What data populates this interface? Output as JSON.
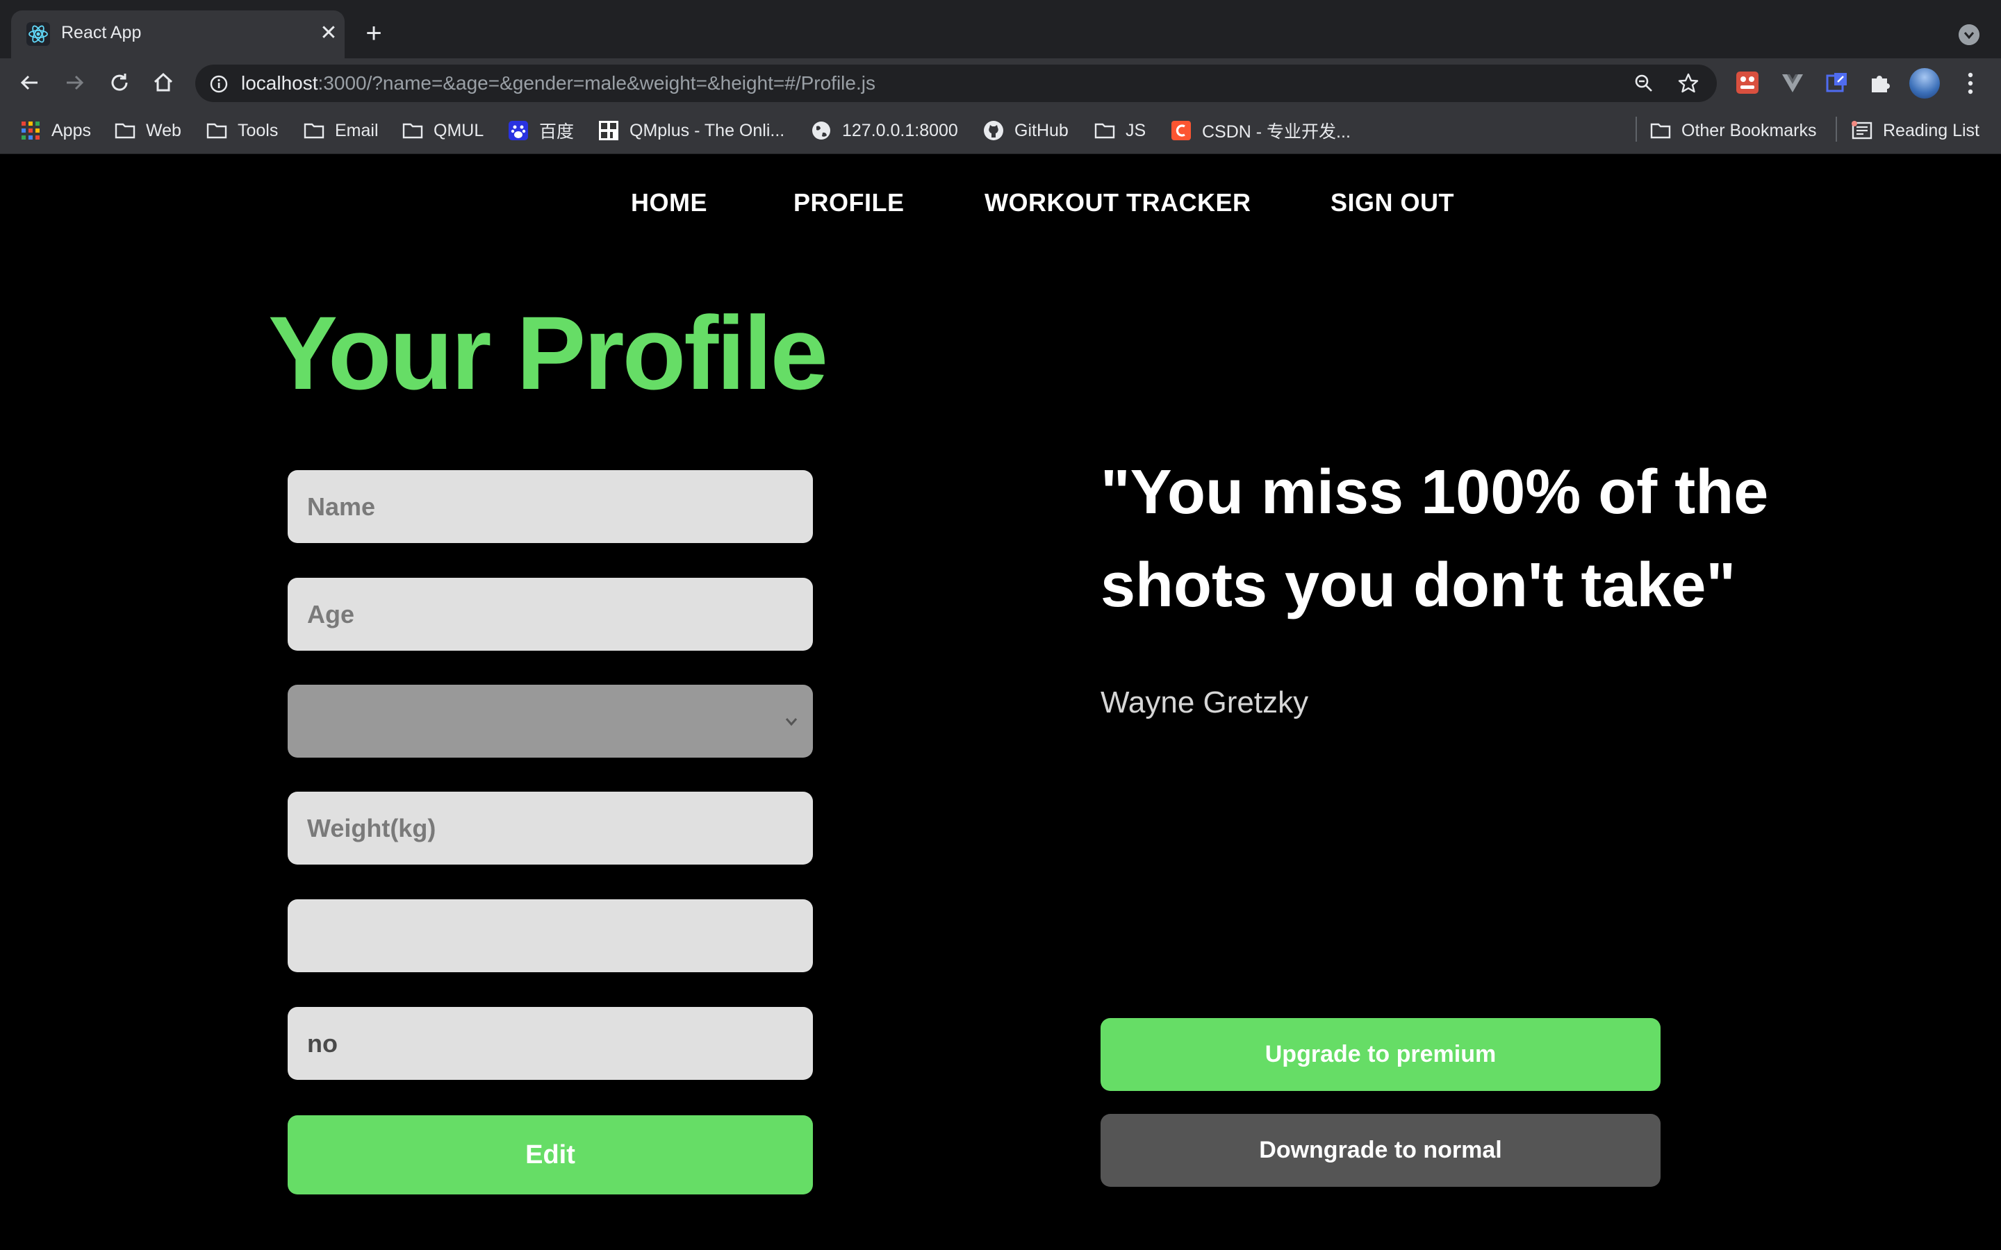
{
  "browser": {
    "tab": {
      "title": "React App",
      "close_glyph": "✕",
      "favicon": "react-logo-icon"
    },
    "new_tab_glyph": "+",
    "address": {
      "host": "localhost",
      "rest": ":3000/?name=&age=&gender=male&weight=&height=#/Profile.js"
    },
    "bookmarks": [
      {
        "label": "Apps",
        "icon": "apps-grid-icon"
      },
      {
        "label": "Web",
        "icon": "folder-icon"
      },
      {
        "label": "Tools",
        "icon": "folder-icon"
      },
      {
        "label": "Email",
        "icon": "folder-icon"
      },
      {
        "label": "QMUL",
        "icon": "folder-icon"
      },
      {
        "label": "百度",
        "icon": "baidu-icon"
      },
      {
        "label": "QMplus - The Onli...",
        "icon": "qmplus-icon"
      },
      {
        "label": "127.0.0.1:8000",
        "icon": "globe-icon"
      },
      {
        "label": "GitHub",
        "icon": "github-icon"
      },
      {
        "label": "JS",
        "icon": "folder-icon"
      },
      {
        "label": "CSDN - 专业开发...",
        "icon": "csdn-icon"
      }
    ],
    "other_bookmarks": "Other Bookmarks",
    "reading_list": "Reading List"
  },
  "nav": {
    "home": "HOME",
    "profile": "PROFILE",
    "workout_tracker": "WORKOUT TRACKER",
    "sign_out": "SIGN OUT"
  },
  "profile": {
    "title": "Your Profile",
    "name_placeholder": "Name",
    "age_placeholder": "Age",
    "gender_value": "",
    "weight_placeholder": "Weight(kg)",
    "height_value": "",
    "premium_value": "no",
    "edit_label": "Edit"
  },
  "quote": {
    "text": "\"You miss 100% of the shots you don't take\"",
    "author": "Wayne Gretzky"
  },
  "actions": {
    "upgrade_label": "Upgrade to premium",
    "downgrade_label": "Downgrade to normal"
  },
  "colors": {
    "accent_green": "#66dd66",
    "field_bg": "#e0e0e0",
    "downgrade_bg": "#555555",
    "page_bg": "#000000"
  }
}
